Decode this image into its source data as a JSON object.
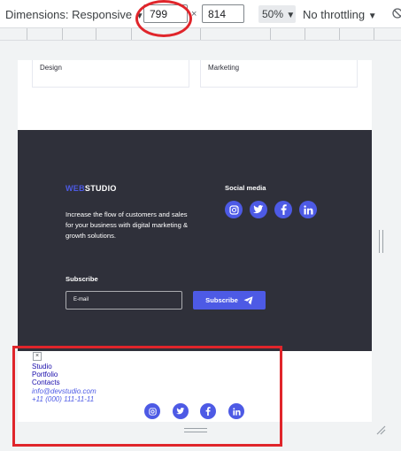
{
  "toolbar": {
    "dimensions_label": "Dimensions: Responsive",
    "width_value": "799",
    "times": "×",
    "height_value": "814",
    "zoom": "50%",
    "throttle": "No throttling",
    "caret": "▼"
  },
  "cards": [
    "Design",
    "Marketing"
  ],
  "footer": {
    "logo_accent": "WEB",
    "logo_main": "STUDIO",
    "description": "Increase the flow of customers and sales for your business with digital marketing & growth solutions.",
    "social_title": "Social media",
    "social_icons": [
      "instagram-icon",
      "twitter-icon",
      "facebook-icon",
      "linkedin-icon"
    ],
    "subscribe_title": "Subscribe",
    "email_placeholder": "E-mail",
    "subscribe_button": "Subscribe"
  },
  "mobile_menu": {
    "close": "×",
    "links": [
      "Studio",
      "Portfolio",
      "Contacts"
    ],
    "email": "info@devstudio.com",
    "phone": "+11 (000) 111-11-11",
    "social_icons": [
      "instagram-icon",
      "twitter-icon",
      "facebook-icon",
      "linkedin-icon"
    ]
  },
  "colors": {
    "accent": "#4d5ae5",
    "footer_bg": "#2f303a",
    "annotation_red": "#e0252b"
  }
}
